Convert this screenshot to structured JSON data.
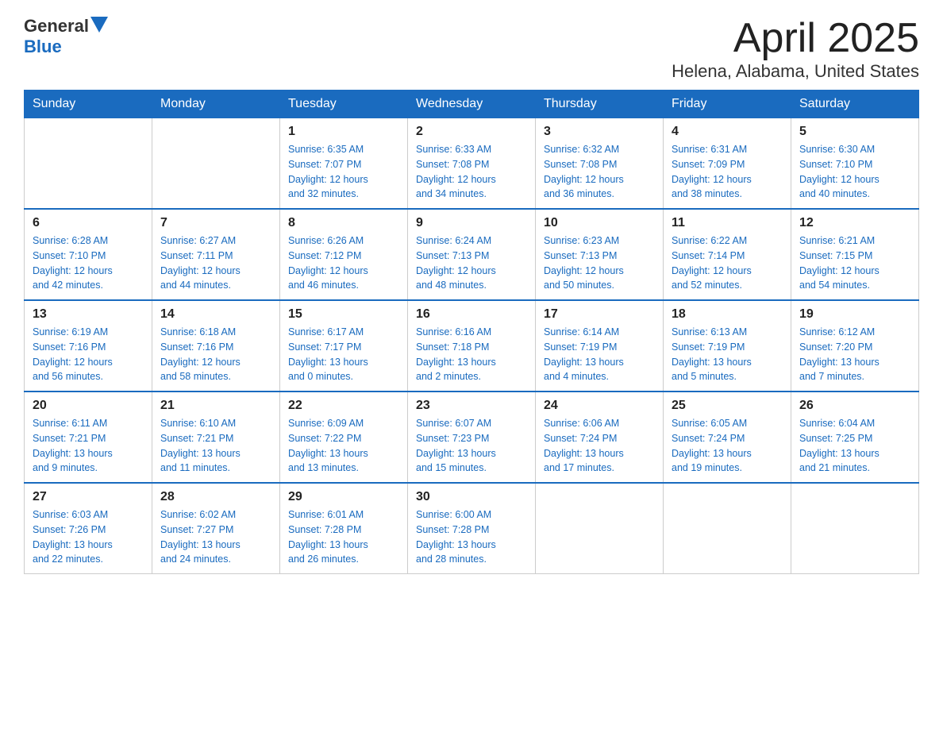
{
  "header": {
    "logo_text_general": "General",
    "logo_text_blue": "Blue",
    "month_title": "April 2025",
    "location": "Helena, Alabama, United States"
  },
  "weekdays": [
    "Sunday",
    "Monday",
    "Tuesday",
    "Wednesday",
    "Thursday",
    "Friday",
    "Saturday"
  ],
  "weeks": [
    [
      {
        "day": "",
        "info": ""
      },
      {
        "day": "",
        "info": ""
      },
      {
        "day": "1",
        "info": "Sunrise: 6:35 AM\nSunset: 7:07 PM\nDaylight: 12 hours\nand 32 minutes."
      },
      {
        "day": "2",
        "info": "Sunrise: 6:33 AM\nSunset: 7:08 PM\nDaylight: 12 hours\nand 34 minutes."
      },
      {
        "day": "3",
        "info": "Sunrise: 6:32 AM\nSunset: 7:08 PM\nDaylight: 12 hours\nand 36 minutes."
      },
      {
        "day": "4",
        "info": "Sunrise: 6:31 AM\nSunset: 7:09 PM\nDaylight: 12 hours\nand 38 minutes."
      },
      {
        "day": "5",
        "info": "Sunrise: 6:30 AM\nSunset: 7:10 PM\nDaylight: 12 hours\nand 40 minutes."
      }
    ],
    [
      {
        "day": "6",
        "info": "Sunrise: 6:28 AM\nSunset: 7:10 PM\nDaylight: 12 hours\nand 42 minutes."
      },
      {
        "day": "7",
        "info": "Sunrise: 6:27 AM\nSunset: 7:11 PM\nDaylight: 12 hours\nand 44 minutes."
      },
      {
        "day": "8",
        "info": "Sunrise: 6:26 AM\nSunset: 7:12 PM\nDaylight: 12 hours\nand 46 minutes."
      },
      {
        "day": "9",
        "info": "Sunrise: 6:24 AM\nSunset: 7:13 PM\nDaylight: 12 hours\nand 48 minutes."
      },
      {
        "day": "10",
        "info": "Sunrise: 6:23 AM\nSunset: 7:13 PM\nDaylight: 12 hours\nand 50 minutes."
      },
      {
        "day": "11",
        "info": "Sunrise: 6:22 AM\nSunset: 7:14 PM\nDaylight: 12 hours\nand 52 minutes."
      },
      {
        "day": "12",
        "info": "Sunrise: 6:21 AM\nSunset: 7:15 PM\nDaylight: 12 hours\nand 54 minutes."
      }
    ],
    [
      {
        "day": "13",
        "info": "Sunrise: 6:19 AM\nSunset: 7:16 PM\nDaylight: 12 hours\nand 56 minutes."
      },
      {
        "day": "14",
        "info": "Sunrise: 6:18 AM\nSunset: 7:16 PM\nDaylight: 12 hours\nand 58 minutes."
      },
      {
        "day": "15",
        "info": "Sunrise: 6:17 AM\nSunset: 7:17 PM\nDaylight: 13 hours\nand 0 minutes."
      },
      {
        "day": "16",
        "info": "Sunrise: 6:16 AM\nSunset: 7:18 PM\nDaylight: 13 hours\nand 2 minutes."
      },
      {
        "day": "17",
        "info": "Sunrise: 6:14 AM\nSunset: 7:19 PM\nDaylight: 13 hours\nand 4 minutes."
      },
      {
        "day": "18",
        "info": "Sunrise: 6:13 AM\nSunset: 7:19 PM\nDaylight: 13 hours\nand 5 minutes."
      },
      {
        "day": "19",
        "info": "Sunrise: 6:12 AM\nSunset: 7:20 PM\nDaylight: 13 hours\nand 7 minutes."
      }
    ],
    [
      {
        "day": "20",
        "info": "Sunrise: 6:11 AM\nSunset: 7:21 PM\nDaylight: 13 hours\nand 9 minutes."
      },
      {
        "day": "21",
        "info": "Sunrise: 6:10 AM\nSunset: 7:21 PM\nDaylight: 13 hours\nand 11 minutes."
      },
      {
        "day": "22",
        "info": "Sunrise: 6:09 AM\nSunset: 7:22 PM\nDaylight: 13 hours\nand 13 minutes."
      },
      {
        "day": "23",
        "info": "Sunrise: 6:07 AM\nSunset: 7:23 PM\nDaylight: 13 hours\nand 15 minutes."
      },
      {
        "day": "24",
        "info": "Sunrise: 6:06 AM\nSunset: 7:24 PM\nDaylight: 13 hours\nand 17 minutes."
      },
      {
        "day": "25",
        "info": "Sunrise: 6:05 AM\nSunset: 7:24 PM\nDaylight: 13 hours\nand 19 minutes."
      },
      {
        "day": "26",
        "info": "Sunrise: 6:04 AM\nSunset: 7:25 PM\nDaylight: 13 hours\nand 21 minutes."
      }
    ],
    [
      {
        "day": "27",
        "info": "Sunrise: 6:03 AM\nSunset: 7:26 PM\nDaylight: 13 hours\nand 22 minutes."
      },
      {
        "day": "28",
        "info": "Sunrise: 6:02 AM\nSunset: 7:27 PM\nDaylight: 13 hours\nand 24 minutes."
      },
      {
        "day": "29",
        "info": "Sunrise: 6:01 AM\nSunset: 7:28 PM\nDaylight: 13 hours\nand 26 minutes."
      },
      {
        "day": "30",
        "info": "Sunrise: 6:00 AM\nSunset: 7:28 PM\nDaylight: 13 hours\nand 28 minutes."
      },
      {
        "day": "",
        "info": ""
      },
      {
        "day": "",
        "info": ""
      },
      {
        "day": "",
        "info": ""
      }
    ]
  ]
}
